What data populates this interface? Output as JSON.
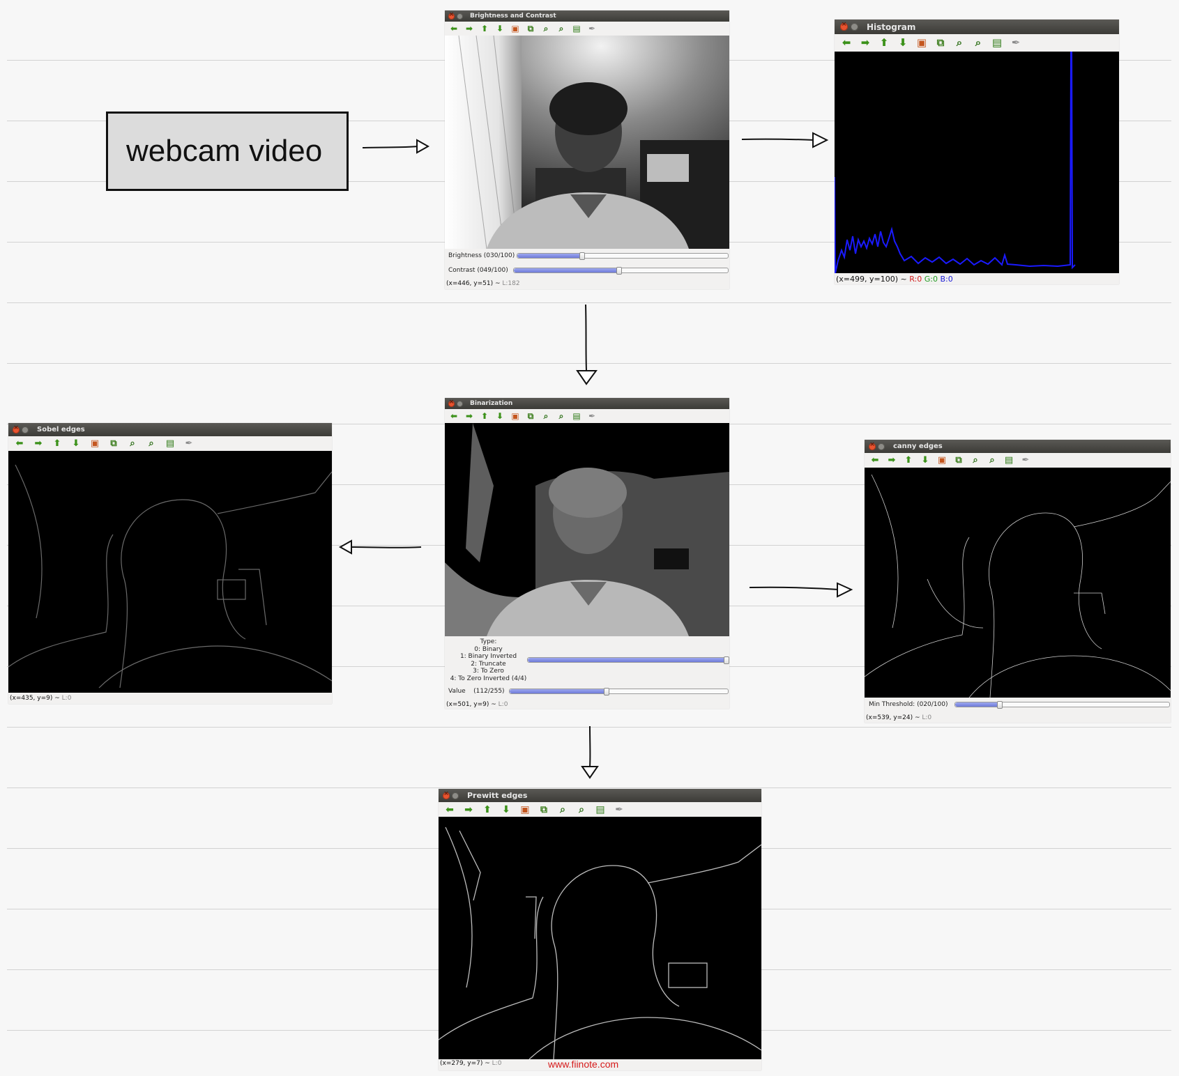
{
  "diagram": {
    "source_node": {
      "label": "webcam video"
    },
    "watermark": "www.fiinote.com"
  },
  "toolbar_icons": [
    "pan-left-icon",
    "pan-right-icon",
    "pan-up-icon",
    "pan-down-icon",
    "reset-zoom-image-icon",
    "zoom-to-selection-icon",
    "zoom-in-icon",
    "zoom-out-icon",
    "save-icon",
    "properties-brush-icon"
  ],
  "windows": {
    "brightness": {
      "title": "Brightness and Contrast",
      "trackbars": [
        {
          "label": "Brightness (030/100)",
          "value": 30,
          "max": 100
        },
        {
          "label": "Contrast  (049/100)",
          "value": 49,
          "max": 100
        }
      ],
      "status": {
        "coords": "(x=446, y=51) ~",
        "lum": "L:182"
      }
    },
    "histogram": {
      "title": "Histogram",
      "status": {
        "coords": "(x=499, y=100) ~",
        "r": "R:0",
        "g": "G:0",
        "b": "B:0"
      },
      "colors": {
        "line": "#1a1aff",
        "background": "#000000"
      }
    },
    "binarization": {
      "title": "Binarization",
      "type_trackbar": {
        "label_lines": [
          "Type:",
          "0: Binary",
          "1: Binary Inverted",
          "2: Truncate",
          "3: To Zero",
          "4: To Zero Inverted (4/4)"
        ],
        "value": 4,
        "max": 4
      },
      "value_trackbar": {
        "label": "Value    (112/255)",
        "value": 112,
        "max": 255
      },
      "status": {
        "coords": "(x=501, y=9) ~",
        "lum": "L:0"
      }
    },
    "sobel": {
      "title": "Sobel edges",
      "status": {
        "coords": "(x=435, y=9) ~",
        "lum": "L:0"
      }
    },
    "canny": {
      "title": "canny edges",
      "trackbars": [
        {
          "label": "Min Threshold: (020/100)",
          "value": 20,
          "max": 100
        }
      ],
      "status": {
        "coords": "(x=539, y=24) ~",
        "lum": "L:0"
      }
    },
    "prewitt": {
      "title": "Prewitt edges",
      "status": {
        "coords": "(x=279, y=7) ~",
        "lum": "L:0"
      }
    }
  }
}
